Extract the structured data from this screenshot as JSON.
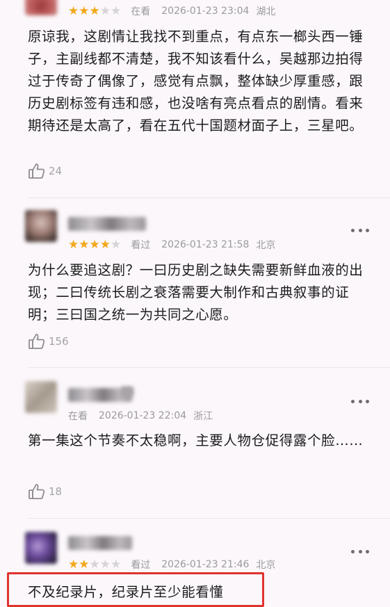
{
  "colors": {
    "star_on": "#f2a71b",
    "star_off": "#d6d3d7",
    "highlight": "#e0322e"
  },
  "reviews": [
    {
      "rating": 3,
      "status": "在看",
      "date": "2026-01-23 23:04",
      "location": "湖北",
      "text": "原谅我，这剧情让我找不到重点，有点东一榔头西一锤子，主副线都不清楚，我不知该看什么，吴越那边拍得过于传奇了偶像了，感觉有点飘，整体缺少厚重感，跟历史剧标签有违和感，也没啥有亮点看点的剧情。看来期待还是太高了，看在五代十国题材面子上，三星吧。",
      "likes": "24",
      "icons": {
        "like": "thumbs-up-icon"
      }
    },
    {
      "rating": 4,
      "status": "看过",
      "date": "2026-01-23 21:58",
      "location": "北京",
      "text": "为什么要追这剧？一曰历史剧之缺失需要新鲜血液的出现；二曰传统长剧之衰落需要大制作和古典叙事的证明；三曰国之统一为共同之心愿。",
      "likes": "156",
      "icons": {
        "more": "more-icon",
        "like": "thumbs-up-icon"
      }
    },
    {
      "rating": 0,
      "status": "在看",
      "date": "2026-01-23 22:04",
      "location": "浙江",
      "text": "第一集这个节奏不太稳啊，主要人物仓促得露个脸……",
      "likes": "18",
      "icons": {
        "more": "more-icon",
        "like": "thumbs-up-icon"
      }
    },
    {
      "rating": 2,
      "status": "看过",
      "date": "2026-01-23 21:46",
      "location": "北京",
      "text": "不及纪录片，纪录片至少能看懂",
      "icons": {
        "more": "more-icon"
      }
    }
  ]
}
